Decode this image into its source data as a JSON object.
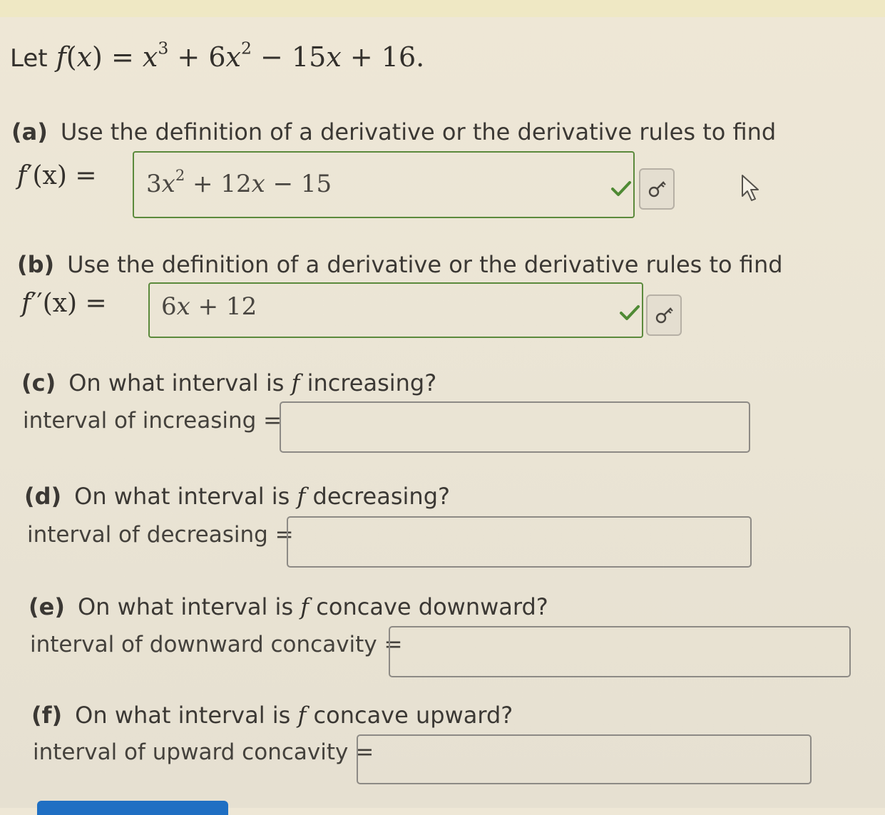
{
  "intro": {
    "let": "Let",
    "fname": "f",
    "var": "x",
    "equals": "=",
    "term1_base": "x",
    "term1_exp": "3",
    "plus1": "+",
    "term2_coef": "6",
    "term2_base": "x",
    "term2_exp": "2",
    "minus": "−",
    "term3": "15",
    "term3_var": "x",
    "plus2": "+",
    "term4": "16."
  },
  "part_a": {
    "tag": "(a)",
    "prompt": "Use the definition of a derivative or the derivative rules to find",
    "lhs_f": "f",
    "lhs_prime": "′",
    "lhs_rest": "(x) =",
    "answer": {
      "coef1": "3",
      "var1": "x",
      "exp1": "2",
      "rest1": " + 12",
      "var2": "x",
      "rest2": " − 15"
    },
    "status": "correct"
  },
  "part_b": {
    "tag": "(b)",
    "prompt": "Use the definition of a derivative or the derivative rules to find",
    "lhs_f": "f",
    "lhs_prime": "′′",
    "lhs_rest": "(x) =",
    "answer": {
      "coef1": "6",
      "var1": "x",
      "rest1": " + 12"
    },
    "status": "correct"
  },
  "part_c": {
    "tag": "(c)",
    "prompt_before": "On what interval is",
    "prompt_var": "f",
    "prompt_after": "increasing?",
    "label": "interval of increasing =",
    "value": ""
  },
  "part_d": {
    "tag": "(d)",
    "prompt_before": "On what interval is",
    "prompt_var": "f",
    "prompt_after": "decreasing?",
    "label": "interval of decreasing =",
    "value": ""
  },
  "part_e": {
    "tag": "(e)",
    "prompt_before": "On what interval is",
    "prompt_var": "f",
    "prompt_after": "concave downward?",
    "label": "interval of downward concavity =",
    "value": ""
  },
  "part_f": {
    "tag": "(f)",
    "prompt_before": "On what interval is",
    "prompt_var": "f",
    "prompt_after": "concave upward?",
    "label": "interval of upward concavity =",
    "value": ""
  },
  "icons": {
    "check": "check-icon",
    "key": "key-icon",
    "cursor": "mouse-pointer-icon"
  },
  "colors": {
    "correct": "#5b8a3c",
    "submit": "#1f6fc3"
  }
}
